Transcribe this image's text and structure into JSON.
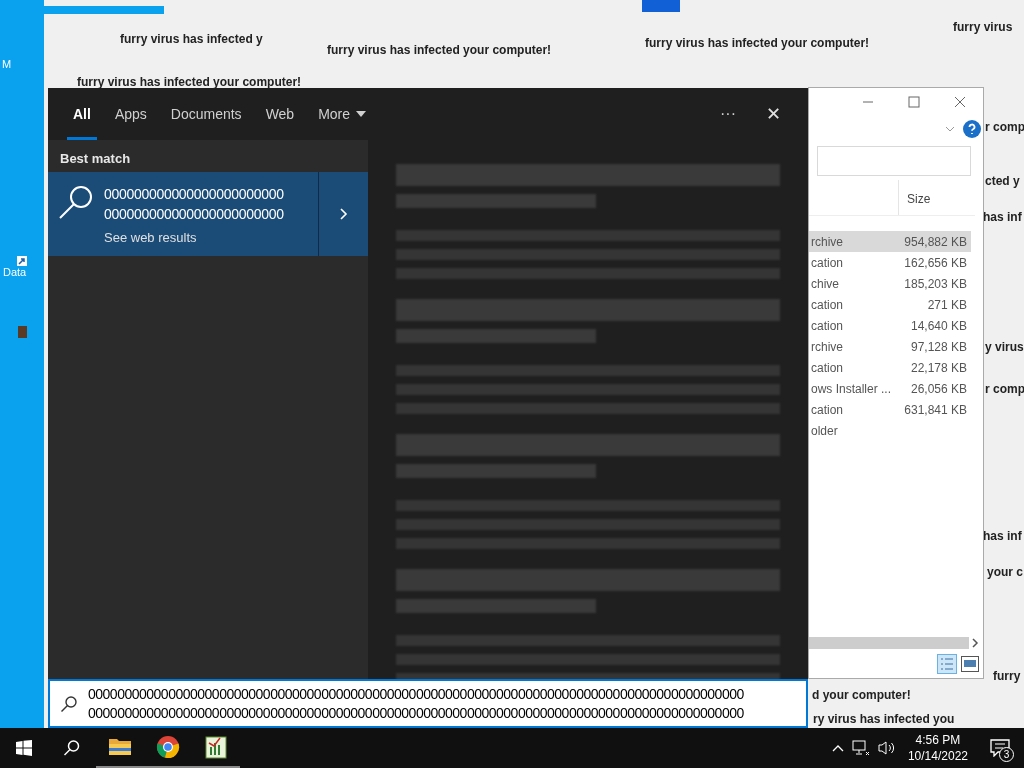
{
  "desktop": {
    "icons": [
      {
        "label": "M"
      },
      {
        "label": "Data"
      }
    ],
    "popups": [
      {
        "text": "furry virus has infected y"
      },
      {
        "text": "furry virus has infected your computer!"
      },
      {
        "text": "furry virus has infected your computer!"
      },
      {
        "text": "furry virus"
      },
      {
        "text": "furry virus has infected your computer!"
      },
      {
        "text": "r comp"
      },
      {
        "text": "cted y"
      },
      {
        "text": "has inf"
      },
      {
        "text": "y virus"
      },
      {
        "text": "r comp"
      },
      {
        "text": "has inf"
      },
      {
        "text": "your c"
      },
      {
        "text": "furry"
      },
      {
        "text": "d your computer!"
      },
      {
        "text": "ry virus has infected you"
      }
    ]
  },
  "explorer": {
    "size_header": "Size",
    "rows": [
      {
        "type": "rchive",
        "size": "954,882 KB",
        "selected": true
      },
      {
        "type": "cation",
        "size": "162,656 KB",
        "selected": false
      },
      {
        "type": "chive",
        "size": "185,203 KB",
        "selected": false
      },
      {
        "type": "cation",
        "size": "271 KB",
        "selected": false
      },
      {
        "type": "cation",
        "size": "14,640 KB",
        "selected": false
      },
      {
        "type": "rchive",
        "size": "97,128 KB",
        "selected": false
      },
      {
        "type": "cation",
        "size": "22,178 KB",
        "selected": false
      },
      {
        "type": "ows Installer ...",
        "size": "26,056 KB",
        "selected": false
      },
      {
        "type": "cation",
        "size": "631,841 KB",
        "selected": false
      },
      {
        "type": "older",
        "selected": false
      }
    ]
  },
  "search": {
    "tabs": [
      {
        "label": "All",
        "selected": true
      },
      {
        "label": "Apps",
        "selected": false
      },
      {
        "label": "Documents",
        "selected": false
      },
      {
        "label": "Web",
        "selected": false
      },
      {
        "label": "More",
        "selected": false
      }
    ],
    "more_menu": "···",
    "close": "✕",
    "section": "Best match",
    "best_match": {
      "lines": [
        "000000000000000000000000",
        "000000000000000000000000"
      ],
      "subtitle": "See web results"
    },
    "query_lines": [
      "000000000000000000000000000000000000000000000000000000000000000000000000000000000000000000",
      "000000000000000000000000000000000000000000000000000000000000000000000000000000000000000000"
    ]
  },
  "taskbar": {
    "apps": [
      {
        "kind": "start",
        "running": false
      },
      {
        "kind": "search",
        "running": false
      },
      {
        "kind": "folder",
        "running": true
      },
      {
        "kind": "chrome",
        "running": true
      },
      {
        "kind": "chart",
        "running": true
      }
    ],
    "time": "4:56 PM",
    "date": "10/14/2022",
    "notifications": "3"
  }
}
